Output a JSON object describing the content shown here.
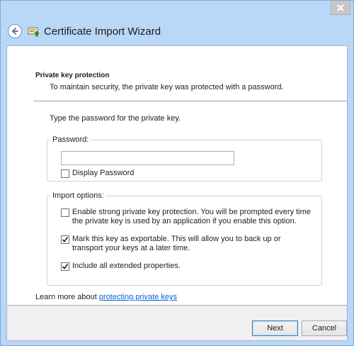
{
  "window": {
    "title": "Certificate Import Wizard",
    "accent_color": "#b9d7f6"
  },
  "page": {
    "heading": "Private key protection",
    "subheading": "To maintain security, the private key was protected with a password.",
    "prompt": "Type the password for the private key."
  },
  "password_group": {
    "label": "Password:",
    "value": "",
    "display_password": {
      "label": "Display Password",
      "checked": false
    }
  },
  "import_options": {
    "label": "Import options:",
    "options": [
      {
        "label": "Enable strong private key protection. You will be prompted every time the private key is used by an application if you enable this option.",
        "checked": false
      },
      {
        "label": "Mark this key as exportable. This will allow you to back up or transport your keys at a later time.",
        "checked": true
      },
      {
        "label": "Include all extended properties.",
        "checked": true
      }
    ]
  },
  "learn_more": {
    "prefix": "Learn more about ",
    "link_text": "protecting private keys"
  },
  "footer": {
    "next_label": "Next",
    "cancel_label": "Cancel"
  }
}
